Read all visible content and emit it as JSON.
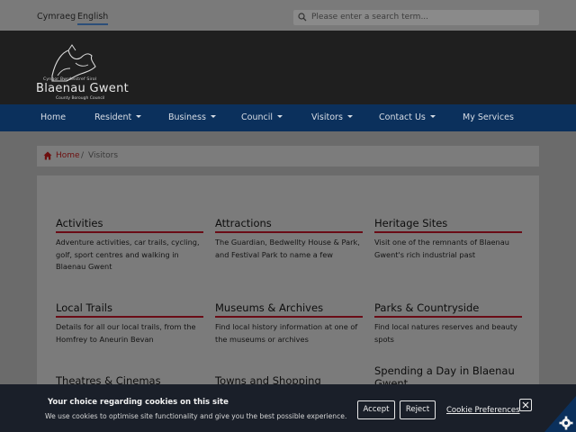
{
  "lang": {
    "welsh": "Cymraeg",
    "english": "English"
  },
  "search": {
    "placeholder": "Please enter a search term..."
  },
  "logo": {
    "welsh_text": "Cyngor Bwrdeistref Sirol",
    "name": "Blaenau Gwent",
    "subtitle": "County Borough Council"
  },
  "nav": {
    "items": [
      {
        "label": "Home"
      },
      {
        "label": "Resident"
      },
      {
        "label": "Business"
      },
      {
        "label": "Council"
      },
      {
        "label": "Visitors"
      },
      {
        "label": "Contact Us"
      },
      {
        "label": "My Services"
      }
    ]
  },
  "breadcrumb": {
    "home": "Home",
    "separator": "/",
    "current": "Visitors"
  },
  "cards": [
    {
      "title": "Activities",
      "desc": "Adventure activities, car trails, cycling, golf, sport centres and walking in Blaenau Gwent"
    },
    {
      "title": "Attractions",
      "desc": "The Guardian, Bedwellty House & Park, and Festival Park to name a few"
    },
    {
      "title": "Heritage Sites",
      "desc": "Visit one of the remnants of Blaenau Gwent's rich industrial past"
    },
    {
      "title": "Local Trails",
      "desc": "Details for all our local trails, from the Homfrey to Aneurin Bevan"
    },
    {
      "title": "Museums & Archives",
      "desc": "Find local history information at one of the museums or archives"
    },
    {
      "title": "Parks & Countryside",
      "desc": "Find local natures reserves and beauty spots"
    },
    {
      "title": "Theatres & Cinemas",
      "desc": ""
    },
    {
      "title": "Towns and Shopping",
      "desc": ""
    },
    {
      "title": "Spending a Day in Blaenau Gwent",
      "desc": ""
    }
  ],
  "cookie": {
    "title": "Your choice regarding cookies on this site",
    "text": "We use cookies to optimise site functionality and give you the best possible experience.",
    "accept": "Accept",
    "reject": "Reject",
    "preferences": "Cookie Preferences"
  },
  "colors": {
    "nav_bg": "#0b305c",
    "header_bg": "#1f1f1f",
    "accent_underline": "#6a0b16",
    "cookie_bg": "#1a1f29"
  }
}
